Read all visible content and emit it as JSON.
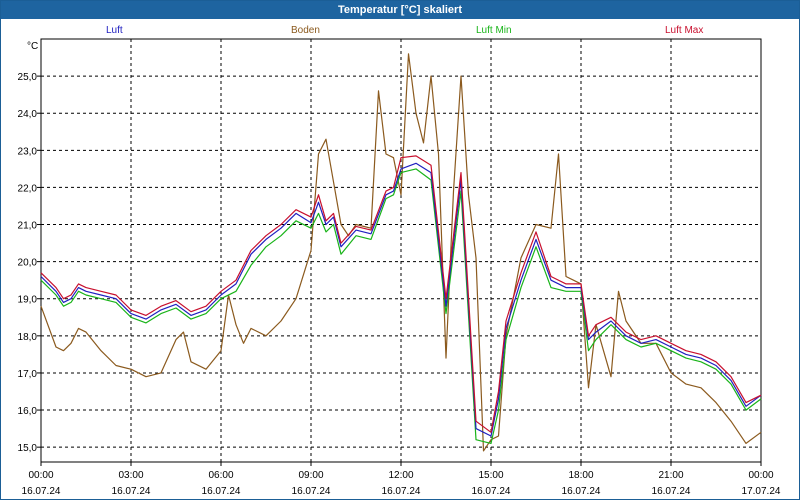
{
  "window": {
    "title": "Temperatur [°C] skaliert"
  },
  "colors": {
    "titlebar": "#1e64a0",
    "luft": "#2020c0",
    "boden": "#8b5a1e",
    "luft_min": "#19b419",
    "luft_max": "#c8102e",
    "grid": "#000000"
  },
  "chart_data": {
    "type": "line",
    "title": "Temperatur [°C] skaliert",
    "ylabel": "°C",
    "ylim": [
      14.6,
      26.0
    ],
    "yticks": [
      "15,0",
      "16,0",
      "17,0",
      "18,0",
      "19,0",
      "20,0",
      "21,0",
      "22,0",
      "23,0",
      "24,0",
      "25,0"
    ],
    "xlim": [
      0,
      24
    ],
    "xticks": [
      {
        "time": "00:00",
        "date": "16.07.24"
      },
      {
        "time": "03:00",
        "date": "16.07.24"
      },
      {
        "time": "06:00",
        "date": "16.07.24"
      },
      {
        "time": "09:00",
        "date": "16.07.24"
      },
      {
        "time": "12:00",
        "date": "16.07.24"
      },
      {
        "time": "15:00",
        "date": "16.07.24"
      },
      {
        "time": "18:00",
        "date": "16.07.24"
      },
      {
        "time": "21:00",
        "date": "16.07.24"
      },
      {
        "time": "00:00",
        "date": "17.07.24"
      }
    ],
    "grid": true,
    "legend_position": "top",
    "series": [
      {
        "name": "Luft",
        "color": "#2020c0",
        "x": [
          0,
          0.5,
          0.75,
          1,
          1.25,
          1.5,
          2,
          2.5,
          3,
          3.5,
          4,
          4.5,
          5,
          5.5,
          6,
          6.5,
          7,
          7.5,
          8,
          8.5,
          9,
          9.25,
          9.5,
          9.75,
          10,
          10.5,
          11,
          11.5,
          11.75,
          12,
          12.5,
          13,
          13.5,
          14,
          14.5,
          15,
          15.25,
          15.5,
          16,
          16.5,
          17,
          17.5,
          18,
          18.25,
          18.5,
          19,
          19.5,
          20,
          20.5,
          21,
          21.5,
          22,
          22.5,
          23,
          23.5,
          24
        ],
        "values": [
          19.6,
          19.2,
          18.9,
          19.0,
          19.3,
          19.2,
          19.1,
          19.0,
          18.6,
          18.45,
          18.7,
          18.85,
          18.55,
          18.7,
          19.1,
          19.4,
          20.2,
          20.6,
          20.9,
          21.3,
          21.05,
          21.6,
          21.0,
          21.2,
          20.4,
          20.85,
          20.75,
          21.8,
          21.9,
          22.5,
          22.65,
          22.4,
          18.8,
          22.2,
          15.5,
          15.3,
          16.3,
          18.2,
          19.5,
          20.6,
          19.5,
          19.3,
          19.3,
          17.9,
          18.1,
          18.4,
          18.0,
          17.8,
          17.9,
          17.7,
          17.5,
          17.4,
          17.2,
          16.8,
          16.1,
          16.4
        ]
      },
      {
        "name": "Boden",
        "color": "#8b5a1e",
        "x": [
          0,
          0.5,
          0.75,
          1,
          1.25,
          1.5,
          2,
          2.5,
          3,
          3.5,
          4,
          4.5,
          4.75,
          5,
          5.5,
          6,
          6.25,
          6.5,
          6.75,
          7,
          7.5,
          8,
          8.5,
          9,
          9.25,
          9.5,
          10,
          10.25,
          10.5,
          11,
          11.25,
          11.5,
          11.75,
          12,
          12.25,
          12.5,
          12.75,
          13,
          13.25,
          13.5,
          13.75,
          14,
          14.25,
          14.5,
          14.75,
          15,
          15.25,
          15.5,
          16,
          16.5,
          17,
          17.25,
          17.5,
          17.75,
          18,
          18.25,
          18.5,
          19,
          19.25,
          19.5,
          20,
          20.5,
          21,
          21.5,
          22,
          22.5,
          23,
          23.5,
          24
        ],
        "values": [
          18.8,
          17.7,
          17.6,
          17.8,
          18.2,
          18.1,
          17.6,
          17.2,
          17.1,
          16.9,
          17.0,
          17.9,
          18.1,
          17.3,
          17.1,
          17.6,
          19.1,
          18.3,
          17.8,
          18.2,
          18.0,
          18.4,
          19.0,
          20.3,
          22.9,
          23.3,
          21.0,
          20.7,
          21.0,
          20.9,
          24.6,
          22.9,
          22.8,
          21.8,
          25.6,
          24.0,
          23.2,
          25.0,
          22.9,
          17.4,
          21.9,
          25.0,
          21.8,
          20.1,
          14.9,
          15.2,
          15.3,
          18.0,
          20.1,
          21.0,
          20.9,
          22.9,
          19.6,
          19.5,
          19.4,
          16.6,
          18.3,
          16.9,
          19.2,
          18.4,
          17.8,
          17.8,
          17.0,
          16.7,
          16.6,
          16.2,
          15.7,
          15.1,
          15.4
        ]
      },
      {
        "name": "Luft Min",
        "color": "#19b419",
        "x": [
          0,
          0.5,
          0.75,
          1,
          1.25,
          1.5,
          2,
          2.5,
          3,
          3.5,
          4,
          4.5,
          5,
          5.5,
          6,
          6.5,
          7,
          7.5,
          8,
          8.5,
          9,
          9.25,
          9.5,
          9.75,
          10,
          10.5,
          11,
          11.5,
          11.75,
          12,
          12.5,
          13,
          13.5,
          14,
          14.5,
          15,
          15.25,
          15.5,
          16,
          16.5,
          17,
          17.5,
          18,
          18.25,
          18.5,
          19,
          19.5,
          20,
          20.5,
          21,
          21.5,
          22,
          22.5,
          23,
          23.5,
          24
        ],
        "values": [
          19.5,
          19.1,
          18.8,
          18.9,
          19.2,
          19.1,
          19.0,
          18.9,
          18.5,
          18.35,
          18.6,
          18.75,
          18.45,
          18.6,
          19.0,
          19.2,
          19.9,
          20.4,
          20.7,
          21.1,
          20.9,
          21.3,
          20.8,
          21.0,
          20.2,
          20.7,
          20.6,
          21.7,
          21.8,
          22.4,
          22.5,
          22.2,
          18.6,
          21.9,
          15.2,
          15.1,
          16.0,
          17.9,
          19.3,
          20.4,
          19.3,
          19.2,
          19.2,
          17.6,
          17.9,
          18.3,
          17.9,
          17.7,
          17.8,
          17.6,
          17.4,
          17.3,
          17.1,
          16.7,
          16.0,
          16.3
        ]
      },
      {
        "name": "Luft Max",
        "color": "#c8102e",
        "x": [
          0,
          0.5,
          0.75,
          1,
          1.25,
          1.5,
          2,
          2.5,
          3,
          3.5,
          4,
          4.5,
          5,
          5.5,
          6,
          6.5,
          7,
          7.5,
          8,
          8.5,
          9,
          9.25,
          9.5,
          9.75,
          10,
          10.5,
          11,
          11.5,
          11.75,
          12,
          12.5,
          13,
          13.5,
          14,
          14.5,
          15,
          15.25,
          15.5,
          16,
          16.5,
          17,
          17.5,
          18,
          18.25,
          18.5,
          19,
          19.5,
          20,
          20.5,
          21,
          21.5,
          22,
          22.5,
          23,
          23.5,
          24
        ],
        "values": [
          19.7,
          19.3,
          19.0,
          19.1,
          19.4,
          19.3,
          19.2,
          19.1,
          18.7,
          18.55,
          18.8,
          18.95,
          18.65,
          18.8,
          19.2,
          19.5,
          20.3,
          20.7,
          21.0,
          21.4,
          21.2,
          21.8,
          21.1,
          21.3,
          20.5,
          20.95,
          20.85,
          21.9,
          22.0,
          22.8,
          22.85,
          22.6,
          19.0,
          22.4,
          15.7,
          15.4,
          16.5,
          18.4,
          19.7,
          20.8,
          19.6,
          19.4,
          19.4,
          18.0,
          18.3,
          18.5,
          18.1,
          17.9,
          18.0,
          17.8,
          17.6,
          17.5,
          17.3,
          16.9,
          16.2,
          16.4
        ]
      }
    ]
  }
}
